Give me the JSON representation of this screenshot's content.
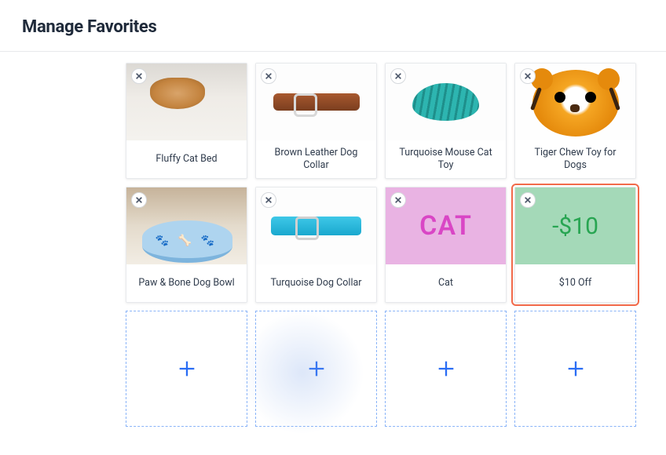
{
  "header": {
    "title": "Manage Favorites"
  },
  "cards": [
    {
      "label": "Fluffy Cat Bed",
      "imgClass": "img-fluffy-bed",
      "highlighted": false
    },
    {
      "label": "Brown Leather Dog Collar",
      "imgClass": "img-leather-collar",
      "highlighted": false
    },
    {
      "label": "Turquoise Mouse Cat Toy",
      "imgClass": "img-mouse-toy",
      "highlighted": false
    },
    {
      "label": "Tiger Chew Toy for Dogs",
      "imgClass": "img-tiger-toy",
      "highlighted": false
    },
    {
      "label": "Paw & Bone Dog Bowl",
      "imgClass": "img-dog-bowl",
      "highlighted": false
    },
    {
      "label": "Turquoise Dog Collar",
      "imgClass": "img-turq-collar",
      "highlighted": false
    },
    {
      "label": "Cat",
      "imgClass": "img-cat",
      "overlayText": "CAT",
      "highlighted": false
    },
    {
      "label": "$10 Off",
      "imgClass": "img-discount",
      "overlayText": "-$10",
      "highlighted": true
    }
  ],
  "addSlots": 4
}
